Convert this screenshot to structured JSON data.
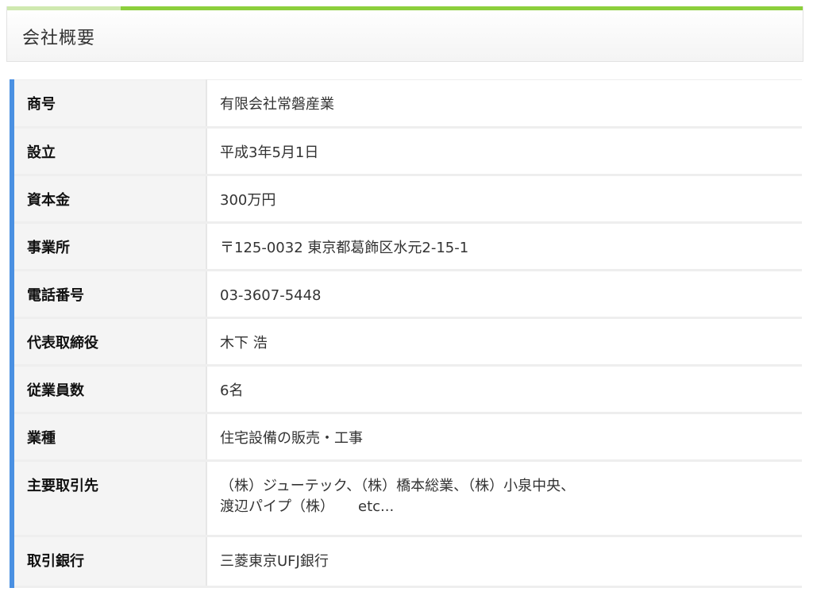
{
  "section": {
    "title": "会社概要"
  },
  "colors": {
    "accent_bar": "#8ccf3c",
    "row_marker": "#4a90e2",
    "label_bg": "#f4f4f4"
  },
  "company_info": [
    {
      "label": "商号",
      "value": "有限会社常磐産業"
    },
    {
      "label": "設立",
      "value": "平成3年5月1日"
    },
    {
      "label": "資本金",
      "value": "300万円"
    },
    {
      "label": "事業所",
      "value": "〒125-0032 東京都葛飾区水元2-15-1"
    },
    {
      "label": "電話番号",
      "value": "03-3607-5448"
    },
    {
      "label": "代表取締役",
      "value": "木下 浩"
    },
    {
      "label": "従業員数",
      "value": "6名"
    },
    {
      "label": "業種",
      "value": "住宅設備の販売・工事"
    },
    {
      "label": "主要取引先",
      "value_line1": "（株）ジューテック、（株）橋本総業、（株）小泉中央、",
      "value_line2": "渡辺パイプ（株）",
      "value_etc": "etc..."
    },
    {
      "label": "取引銀行",
      "value": "三菱東京UFJ銀行"
    }
  ]
}
